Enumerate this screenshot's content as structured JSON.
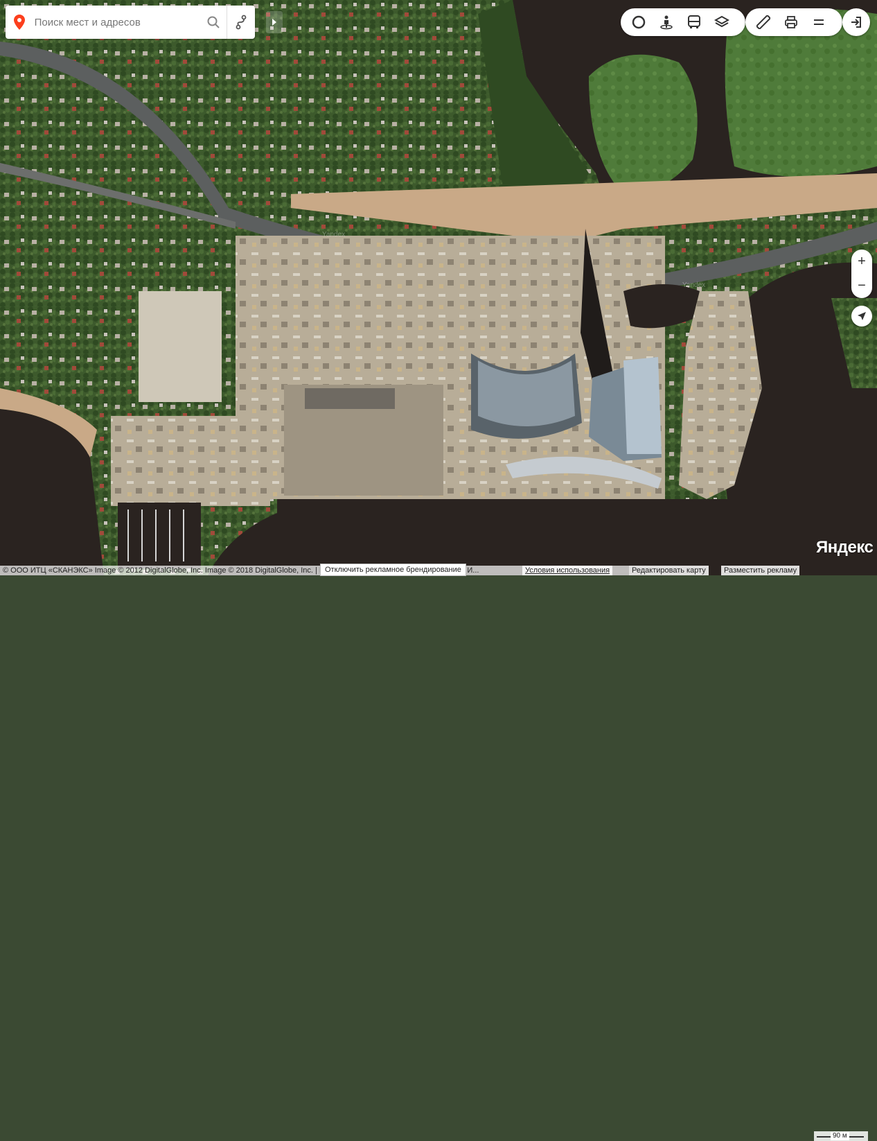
{
  "search": {
    "placeholder": "Поиск мест и адресов"
  },
  "icons": {
    "pin": "location-pin-icon",
    "search": "search-icon",
    "route": "route-icon",
    "collapse": "collapse-arrow-icon",
    "traffic": "traffic-circle-icon",
    "panorama": "panorama-person-icon",
    "transport": "bus-icon",
    "layers": "layers-icon",
    "ruler": "ruler-icon",
    "print": "print-icon",
    "menu": "menu-icon",
    "login": "login-icon",
    "geolocation": "geolocation-arrow-icon"
  },
  "zoom": {
    "in": "+",
    "out": "−"
  },
  "logo": "Яндекс",
  "watermarks": [
    "Yandex",
    "Yandex"
  ],
  "footer": {
    "copyright": "© ООО ИТЦ «СКАНЭКС» Image © 2012 DigitalGlobe, Inc. Image © 2018 DigitalGlobe, Inc. | Правообладателем карты является ООО И...",
    "terms": "Условия использования",
    "edit_map": "Редактировать карту",
    "advertise": "Разместить рекламу",
    "branding_toggle": "Отключить рекламное брендирование",
    "scale": "90 м"
  },
  "colors": {
    "accent_red": "#fc3f1d",
    "icon_gray": "#333333"
  }
}
